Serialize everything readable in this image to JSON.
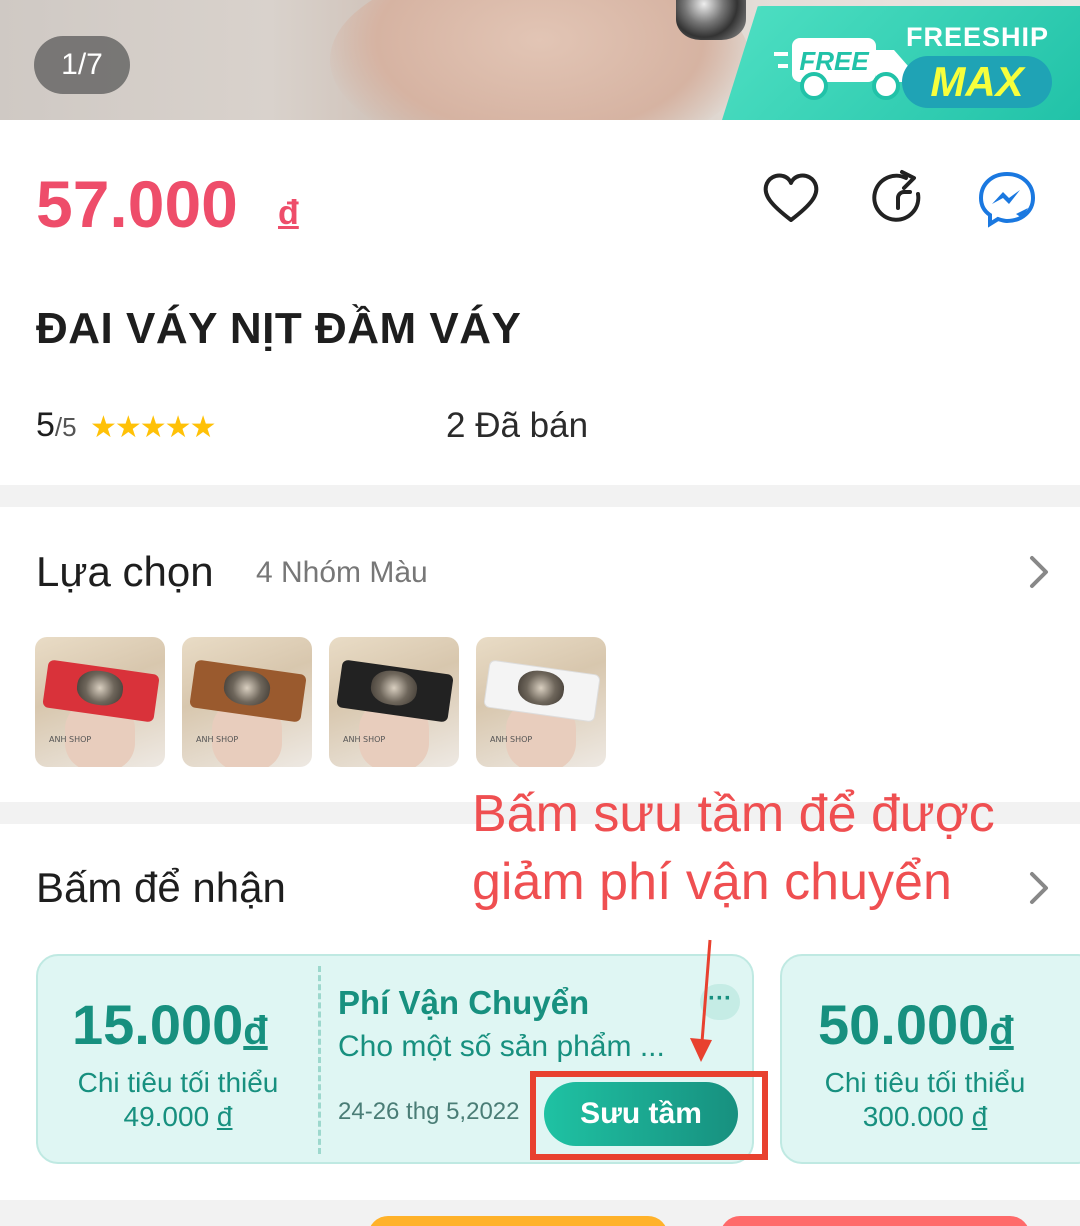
{
  "gallery": {
    "counter": "1/7",
    "badge_top": "FREESHIP",
    "badge_main": "MAX",
    "truck_label": "FREE"
  },
  "product": {
    "price": "57.000",
    "currency": "đ",
    "title": "ĐAI VÁY NỊT ĐẦM VÁY",
    "rating_value": "5",
    "rating_max": "/5",
    "stars": "★★★★★",
    "sold": "2 Đã bán"
  },
  "options": {
    "title": "Lựa chọn",
    "subtitle": "4 Nhóm Màu",
    "thumb_watermark": "ANH SHOP",
    "colors": [
      "#d9323a",
      "#9a5a2e",
      "#222222",
      "#f4f4f4"
    ]
  },
  "vouchers": {
    "title": "Bấm để nhận",
    "annotation": "Bấm sưu tầm để được giảm phí vận chuyển",
    "items": [
      {
        "amount": "15.000",
        "currency": "đ",
        "cond_label": "Chi tiêu tối thiểu",
        "cond_value": "49.000",
        "cond_currency": "đ"
      },
      {
        "name": "Phí Vận Chuyển",
        "desc": "Cho một số sản phẩm ...",
        "date": "24-26 thg 5,2022",
        "more": "···",
        "button": "Sưu tầm"
      },
      {
        "amount": "50.000",
        "currency": "đ",
        "cond_label": "Chi tiêu tối thiểu",
        "cond_value": "300.000",
        "cond_currency": "đ"
      }
    ]
  },
  "icons": [
    "heart-icon",
    "share-icon",
    "messenger-icon",
    "chevron-right-icon"
  ],
  "colors": {
    "price": "#ee4d6a",
    "teal": "#17907f",
    "annotation": "#ef4f51",
    "highlight": "#e8412f"
  }
}
